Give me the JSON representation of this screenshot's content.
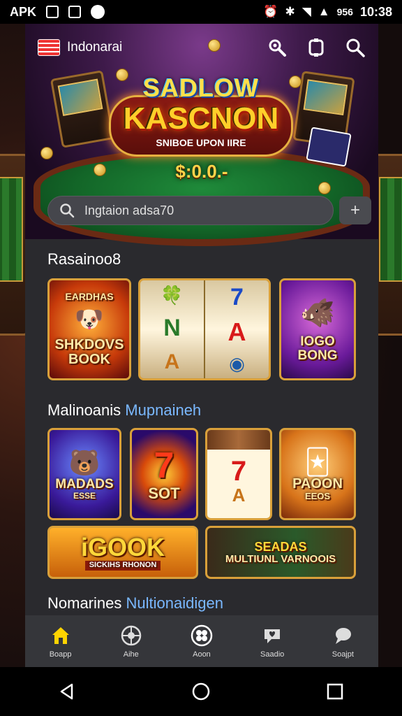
{
  "status_bar": {
    "carrier": "APK",
    "battery_text": "956",
    "time": "10:38"
  },
  "header": {
    "brand": "Indonarai",
    "icons": [
      "search-icon",
      "device-icon",
      "search-icon"
    ]
  },
  "hero": {
    "logo_top": "SADLOW",
    "logo_main": "KASCNON",
    "logo_sub": "SNIBOE UPON IIRE",
    "jackpot": "$:0.0.-"
  },
  "search": {
    "value": "Ingtaion adsa70",
    "add_icon": "plus-icon"
  },
  "sections": [
    {
      "title": "Rasainoo",
      "title_suffix": "8",
      "games": [
        {
          "top": "EARDHAS",
          "label": "SHKDOVS BOOK"
        },
        {
          "reels": [
            [
              "🍀",
              "N",
              "A"
            ],
            [
              "7",
              "A",
              "◉"
            ]
          ]
        },
        {
          "label": "IOGO BONG"
        }
      ]
    },
    {
      "title": "Malinoanis",
      "title_accent": "Mupnaineh",
      "games": [
        {
          "label": "MADADS",
          "sub": "ESSE"
        },
        {
          "label": "SOT",
          "top": "7"
        },
        {
          "reels": [
            "7",
            "A"
          ]
        },
        {
          "label": "PAOON",
          "sub": "EEOS"
        }
      ],
      "banners": [
        {
          "label": "iGOOK",
          "sub": "SICKIHS RHONON"
        },
        {
          "label": "SEADAS",
          "sub": "MULTIUNL VARNOOIS"
        }
      ]
    },
    {
      "title": "Nomarines",
      "title_accent": "Nultionaidigen"
    }
  ],
  "bottom_nav": [
    {
      "label": "Boapp",
      "icon": "home-icon"
    },
    {
      "label": "Aihe",
      "icon": "globe-icon"
    },
    {
      "label": "Aoon",
      "icon": "clover-icon"
    },
    {
      "label": "Saadio",
      "icon": "heart-chat-icon"
    },
    {
      "label": "Soajpt",
      "icon": "chat-icon"
    }
  ],
  "colors": {
    "accent_gold": "#d9a03a",
    "accent_blue_text": "#7ab8ff",
    "home_active": "#ffd400"
  }
}
